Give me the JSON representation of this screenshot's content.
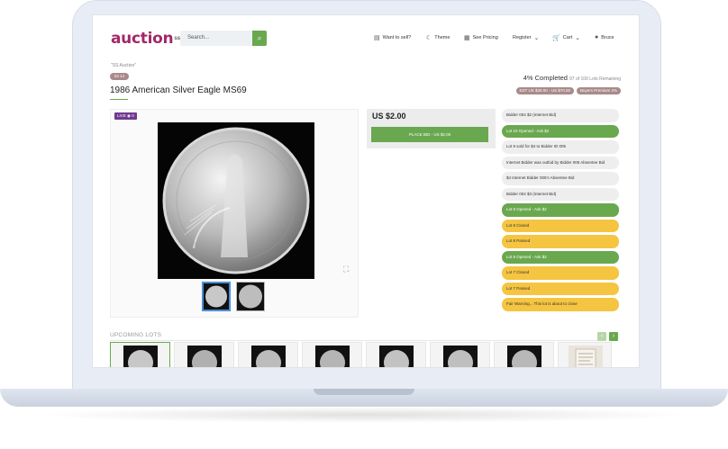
{
  "header": {
    "logo": "auction",
    "logo_suffix": "ss",
    "search_placeholder": "Search...",
    "nav": [
      {
        "label": "Want to sell?",
        "icon": "store-icon"
      },
      {
        "label": "Theme",
        "icon": "moon-icon"
      },
      {
        "label": "See Pricing",
        "icon": "pricing-icon"
      },
      {
        "label": "Register",
        "icon": "chevron-down-icon"
      },
      {
        "label": "Cart",
        "icon": "cart-icon"
      },
      {
        "label": "Bruce",
        "icon": "user-icon"
      }
    ]
  },
  "lot": {
    "breadcrumb": "\"SS Auction\"",
    "tag": "lot 14",
    "title": "1986 American Silver Eagle MS69",
    "progress": "4% Completed",
    "progress_sub": "97 of 100 Lots Remaining",
    "pills": [
      "EST US $30.00 - US $70.00",
      "Buyers Premium 2%"
    ]
  },
  "viewer": {
    "live_badge": "LIVE",
    "views": "0"
  },
  "bid": {
    "price": "US $2.00",
    "button": "PLACE BID - US $2.00"
  },
  "messages": [
    {
      "text": "Bidder 004 $2 (Internet Bid)",
      "kind": "gray"
    },
    {
      "text": "Lot 10 Opened - Ask $2",
      "kind": "green"
    },
    {
      "text": "Lot 9 sold for $4 to Bidder ID 005",
      "kind": "gray"
    },
    {
      "text": "Internet Bidder was outbid by Bidder 005 Absentee Bid",
      "kind": "gray"
    },
    {
      "text": "$4 Internet Bidder 005's Absentee Bid",
      "kind": "gray"
    },
    {
      "text": "Bidder 004 $3 (Internet Bid)",
      "kind": "gray"
    },
    {
      "text": "Lot 9 Opened - Ask $2",
      "kind": "green"
    },
    {
      "text": "Lot 8 Closed",
      "kind": "yellow"
    },
    {
      "text": "Lot 8 Passed",
      "kind": "yellow"
    },
    {
      "text": "Lot 8 Opened - Ask $2",
      "kind": "green"
    },
    {
      "text": "Lot 7 Closed",
      "kind": "yellow"
    },
    {
      "text": "Lot 7 Passed",
      "kind": "yellow"
    },
    {
      "text": "Fair Warning... This lot is about to close",
      "kind": "yellow"
    }
  ],
  "upcoming": {
    "label": "UPCOMING LOTS",
    "prev": "‹",
    "next": "›"
  },
  "colors": {
    "brand": "#a3286a",
    "accent_green": "#6aa84f",
    "warning_yellow": "#f5c542"
  }
}
